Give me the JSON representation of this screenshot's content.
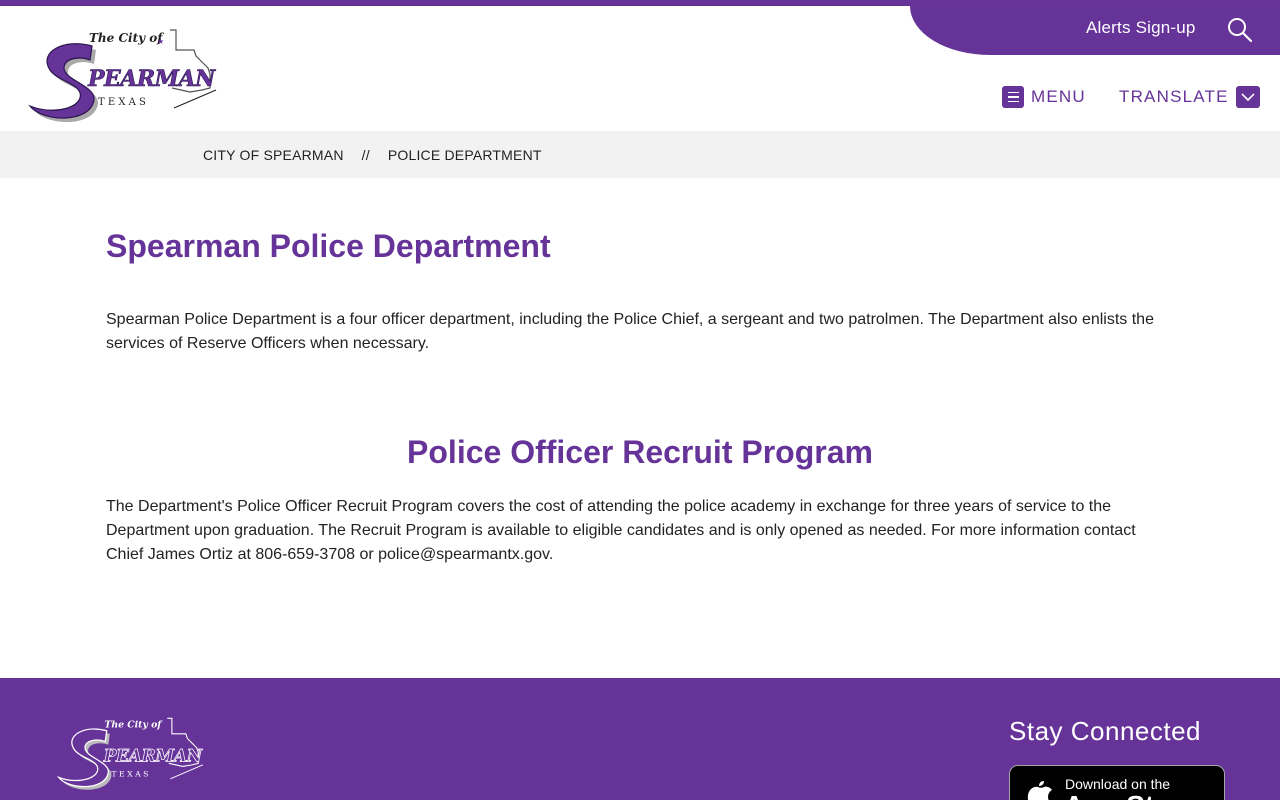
{
  "header": {
    "alerts_label": "Alerts Sign-up",
    "menu_label": "MENU",
    "translate_label": "TRANSLATE",
    "logo": {
      "line1": "The City of",
      "line2": "SPEARMAN",
      "line3": "T E X A S"
    }
  },
  "breadcrumb": {
    "items": [
      "CITY OF SPEARMAN",
      "POLICE DEPARTMENT"
    ],
    "separator": "//"
  },
  "main": {
    "title": "Spearman Police Department",
    "intro": "Spearman Police Department is a four officer department, including the Police Chief, a sergeant and two patrolmen. The Department also enlists the services of Reserve Officers when necessary.",
    "section_title": "Police Officer Recruit Program",
    "section_text": "The Department's Police Officer Recruit Program covers the cost of attending the police academy in exchange for three years of service to the Department upon graduation. The Recruit Program is available to eligible candidates and is only opened as needed. For more information contact Chief James Ortiz at 806-659-3708 or police@spearmantx.gov."
  },
  "footer": {
    "stay_connected": "Stay Connected",
    "appstore_small": "Download on the",
    "appstore_big": "App Store"
  },
  "colors": {
    "brand": "#663399",
    "breadcrumb_bg": "#f2f2f2",
    "text": "#222222"
  },
  "icons": {
    "search": "search-icon",
    "menu": "hamburger-icon",
    "translate": "chevron-down-icon",
    "appstore": "apple-icon"
  }
}
